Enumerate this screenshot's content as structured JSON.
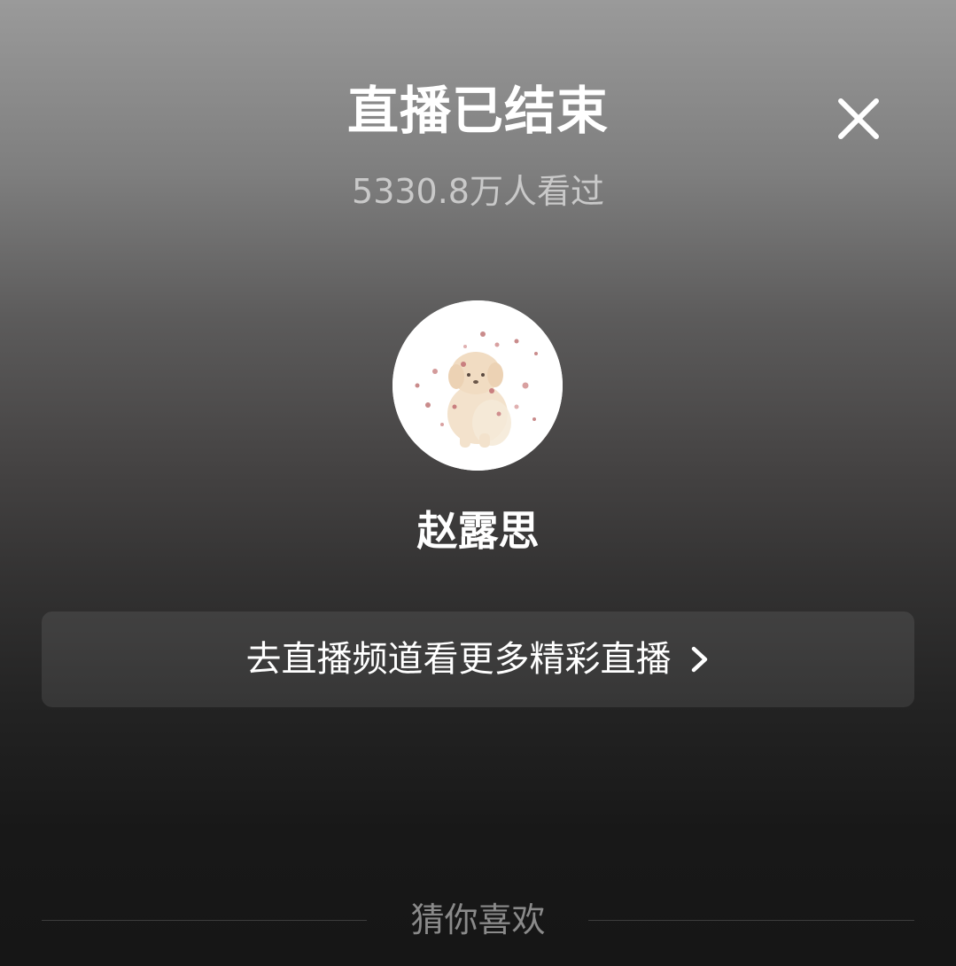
{
  "header": {
    "title": "直播已结束",
    "close_icon": "close-icon"
  },
  "stats": {
    "viewers": "5330.8万人看过"
  },
  "streamer": {
    "avatar_icon": "avatar-image",
    "name": "赵露思"
  },
  "channel_button": {
    "label": "去直播频道看更多精彩直播",
    "icon": "chevron-right-icon"
  },
  "recommend": {
    "label": "猜你喜欢"
  },
  "colors": {
    "text_primary": "#ffffff",
    "text_secondary": "#c9c9c9",
    "text_muted": "#8a8a8a",
    "background_top": "#9a9a9a",
    "background_bottom": "#161616"
  }
}
